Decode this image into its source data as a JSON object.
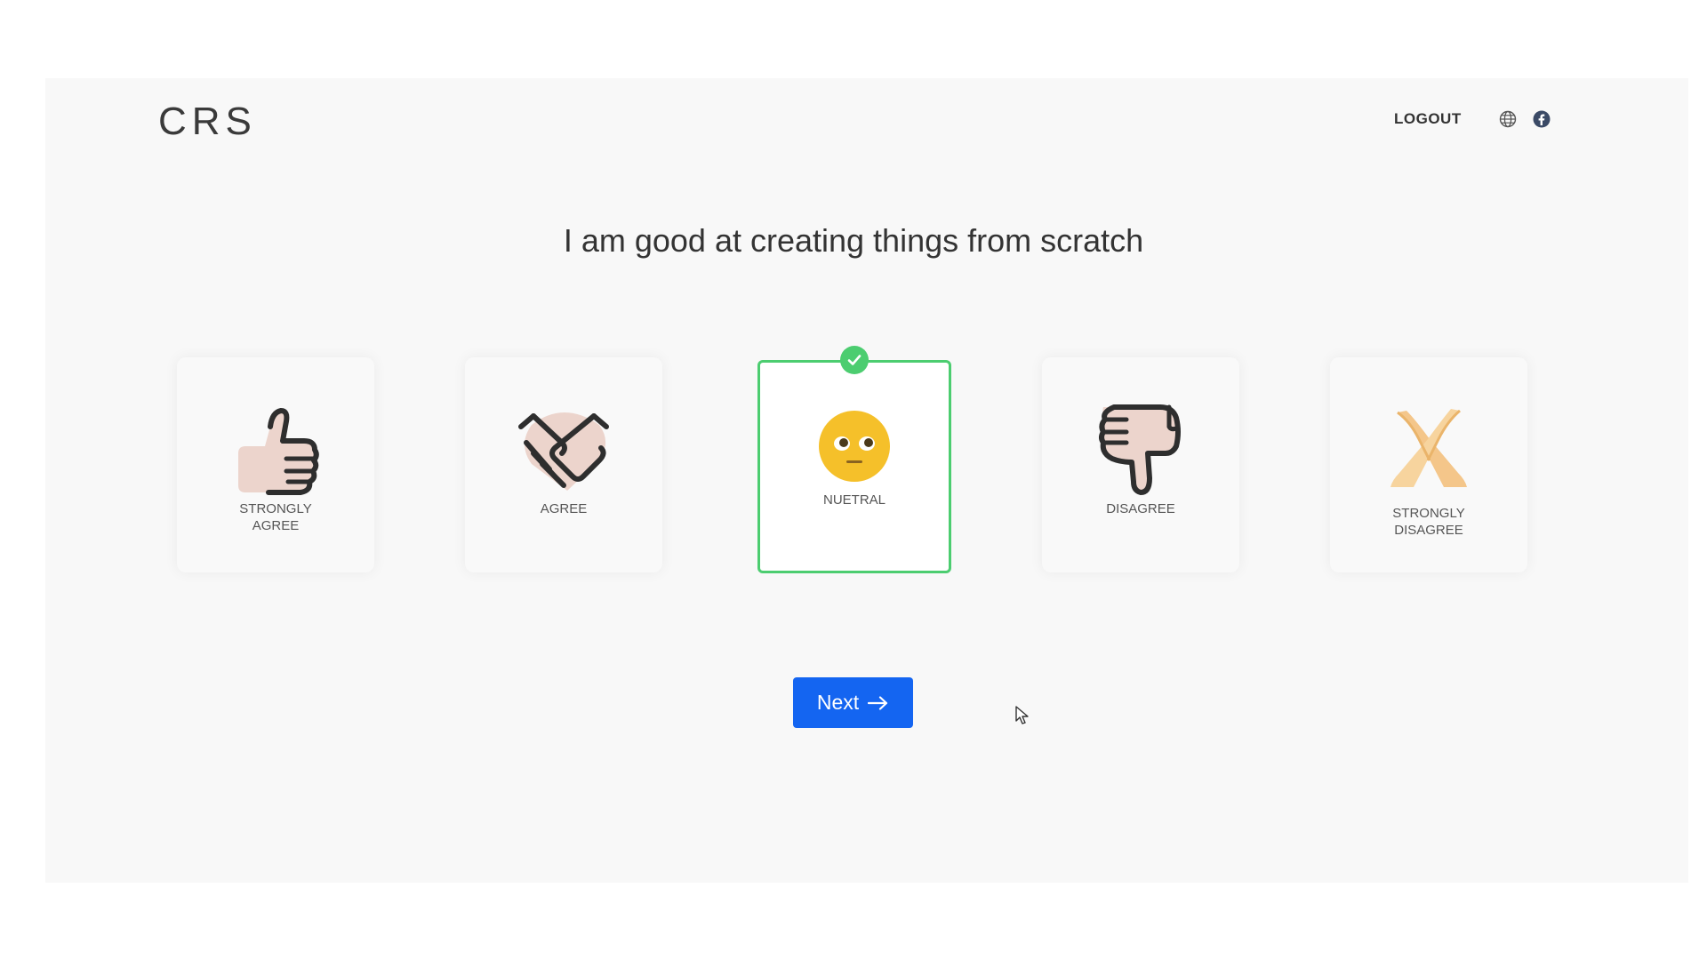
{
  "header": {
    "brand": "CRS",
    "logout_label": "LOGOUT",
    "icons": [
      "globe-icon",
      "facebook-icon"
    ]
  },
  "question": "I am good at creating things from scratch",
  "options": [
    {
      "label": "STRONGLY\nAGREE",
      "icon": "thumbs-up-icon",
      "selected": false
    },
    {
      "label": "AGREE",
      "icon": "handshake-icon",
      "selected": false
    },
    {
      "label": "NUETRAL",
      "icon": "neutral-face-icon",
      "selected": true
    },
    {
      "label": "DISAGREE",
      "icon": "thumbs-down-icon",
      "selected": false
    },
    {
      "label": "STRONGLY\nDISAGREE",
      "icon": "crossed-hands-icon",
      "selected": false
    }
  ],
  "next_button": {
    "label": "Next",
    "icon": "arrow-right-icon"
  },
  "colors": {
    "primary": "#1465f1",
    "selected_border": "#4ccd70",
    "emoji_yellow": "#f5c02a",
    "skin": "#ecd4cc"
  }
}
